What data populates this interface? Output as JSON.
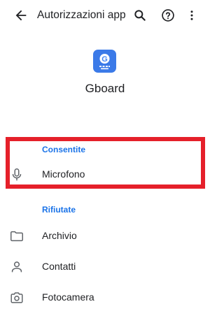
{
  "toolbar": {
    "title": "Autorizzazioni app",
    "icons": [
      "back-arrow-icon",
      "search-icon",
      "help-icon",
      "more-vert-icon"
    ]
  },
  "app": {
    "name": "Gboard",
    "icon": "gboard-app-icon",
    "icon_color": "#3b7ae8"
  },
  "sections": {
    "allowed": {
      "label": "Consentite",
      "items": [
        {
          "label": "Microfono",
          "icon": "microphone-icon"
        }
      ]
    },
    "denied": {
      "label": "Rifiutate",
      "items": [
        {
          "label": "Archivio",
          "icon": "folder-icon"
        },
        {
          "label": "Contatti",
          "icon": "person-icon"
        },
        {
          "label": "Fotocamera",
          "icon": "camera-icon"
        }
      ]
    }
  },
  "colors": {
    "accent": "#1a73e8",
    "highlight": "#e5202a",
    "text": "#202124"
  }
}
